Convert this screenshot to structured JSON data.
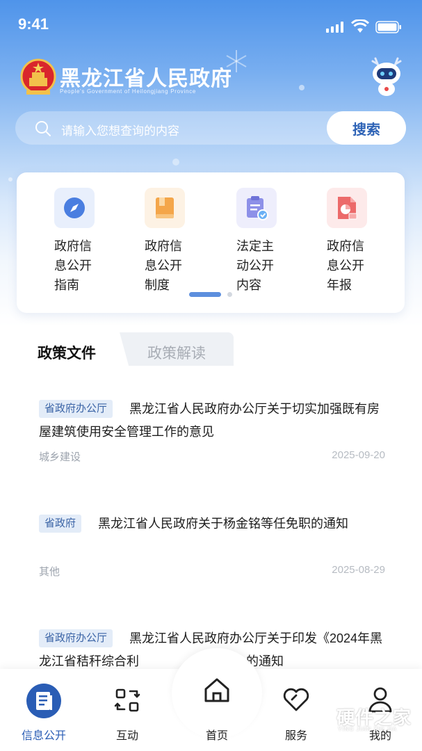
{
  "status": {
    "time": "9:41"
  },
  "header": {
    "title": "黑龙江省人民政府",
    "subtitle": "People's Government of Heilongjiang Province"
  },
  "search": {
    "placeholder": "请输入您想查询的内容",
    "button": "搜索"
  },
  "shortcuts": [
    {
      "lines": [
        "政府信",
        "息公开",
        "指南"
      ],
      "icon": "compass-icon",
      "color": "#4a7ee0"
    },
    {
      "lines": [
        "政府信",
        "息公开",
        "制度"
      ],
      "icon": "book-icon",
      "color": "#f4a64a"
    },
    {
      "lines": [
        "法定主",
        "动公开",
        "内容"
      ],
      "icon": "clipboard-check-icon",
      "color": "#7b7fe0"
    },
    {
      "lines": [
        "政府信",
        "息公开",
        "年报"
      ],
      "icon": "report-chart-icon",
      "color": "#ec6a6a"
    }
  ],
  "tabs": {
    "active": "政策文件",
    "inactive": "政策解读"
  },
  "news": [
    {
      "tag": "省政府办公厅",
      "title": "黑龙江省人民政府办公厅关于切实加强既有房屋建筑使用安全管理工作的意见",
      "category": "城乡建设",
      "date": "2025-09-20"
    },
    {
      "tag": "省政府",
      "title": "黑龙江省人民政府关于杨金铭等任免职的通知",
      "category": "其他",
      "date": "2025-08-29"
    },
    {
      "tag": "省政府办公厅",
      "title": "黑龙江省人民政府办公厅关于印发《2024年黑龙江省秸秆综合利",
      "title_tail": "案》的通知"
    }
  ],
  "tabbar": [
    {
      "label": "信息公开",
      "icon": "document-icon"
    },
    {
      "label": "互动",
      "icon": "exchange-icon"
    },
    {
      "label": "首页",
      "icon": "home-icon"
    },
    {
      "label": "服务",
      "icon": "heart-icon"
    },
    {
      "label": "我的",
      "icon": "user-icon"
    }
  ],
  "watermark": {
    "text": "硬件之家",
    "sub": "YING JIAN ZHI JIA"
  },
  "colors": {
    "brand_blue": "#2e63b6",
    "header_blue": "#4f94ea",
    "tag_bg": "#e3ecf8"
  }
}
